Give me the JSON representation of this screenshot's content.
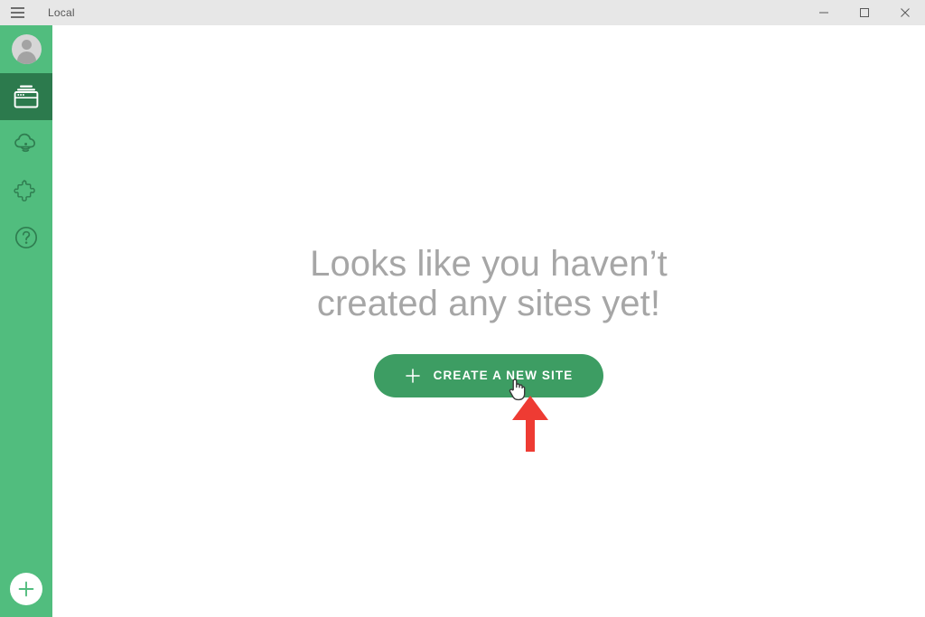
{
  "window": {
    "title": "Local",
    "menu_icon": "hamburger-icon",
    "controls": {
      "minimize": "minimize-icon",
      "maximize": "maximize-icon",
      "close": "close-icon"
    }
  },
  "sidebar": {
    "background_color": "#51bd7e",
    "active_color": "#2c7a4d",
    "account": {
      "name": "account-avatar",
      "icon": "user-avatar-icon"
    },
    "items": [
      {
        "name": "sites",
        "icon": "browser-window-icon",
        "active": true
      },
      {
        "name": "connect",
        "icon": "cloud-icon",
        "active": false
      },
      {
        "name": "add-ons",
        "icon": "puzzle-piece-icon",
        "active": false
      },
      {
        "name": "help",
        "icon": "question-mark-circle-icon",
        "active": false
      }
    ],
    "add_button": {
      "name": "add-new-site",
      "icon": "plus-circle-icon"
    }
  },
  "main": {
    "empty_state": {
      "heading": "Looks like you haven’t created any sites yet!",
      "heading_color": "#a6a6a6",
      "button_label": "CREATE A NEW SITE",
      "button_icon": "plus-icon",
      "button_color": "#3d9d63"
    }
  },
  "annotations": {
    "arrow": {
      "name": "red-arrow-annotation",
      "color": "#ee3b33",
      "direction": "up",
      "points_at": "CREATE A NEW SITE"
    },
    "cursor": {
      "name": "hand-cursor",
      "type": "pointer-hand"
    }
  }
}
